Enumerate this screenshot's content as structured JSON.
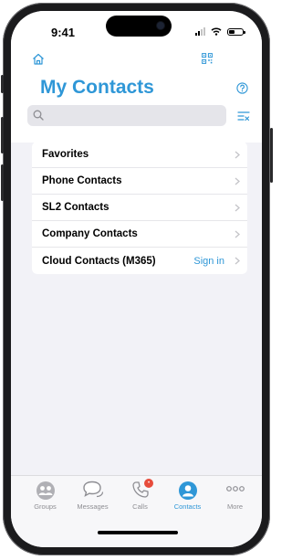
{
  "status_bar": {
    "time": "9:41"
  },
  "header": {
    "home_icon": "house-icon",
    "qr_icon": "qr-code-icon",
    "help_icon": "help-circle-icon",
    "title": "My Contacts"
  },
  "search": {
    "value": "",
    "placeholder": "",
    "icon": "search-icon",
    "filter_icon": "filter-icon"
  },
  "contacts_list": {
    "items": [
      {
        "label": "Favorites",
        "action": ""
      },
      {
        "label": "Phone Contacts",
        "action": ""
      },
      {
        "label": "SL2 Contacts",
        "action": ""
      },
      {
        "label": "Company Contacts",
        "action": ""
      },
      {
        "label": "Cloud Contacts (M365)",
        "action": "Sign in"
      }
    ]
  },
  "tabbar": {
    "tabs": [
      {
        "label": "Groups",
        "icon": "groups-icon",
        "active": false
      },
      {
        "label": "Messages",
        "icon": "messages-icon",
        "active": false
      },
      {
        "label": "Calls",
        "icon": "phone-icon",
        "active": false,
        "badge": "•"
      },
      {
        "label": "Contacts",
        "icon": "person-icon",
        "active": true
      },
      {
        "label": "More",
        "icon": "more-icon",
        "active": false
      }
    ]
  },
  "colors": {
    "accent": "#2f97d7",
    "background": "#f2f2f7",
    "badge": "#e74c3c"
  }
}
